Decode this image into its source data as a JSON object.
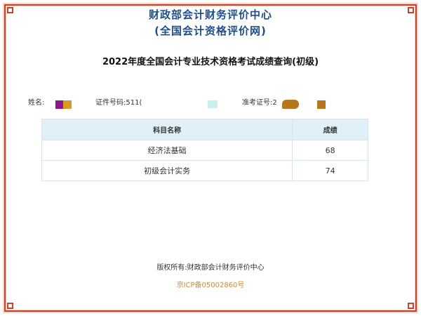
{
  "header": {
    "site_name": "财政部会计财务评价中心",
    "site_subtitle": "(全国会计资格评价网)",
    "exam_title": "2022年度全国会计专业技术资格考试成绩查询(初级)"
  },
  "candidate": {
    "name_label": "姓名:",
    "id_label": "证件号码:511(",
    "admit_label": "准考证号:2"
  },
  "scores_table": {
    "headers": {
      "subject": "科目名称",
      "score": "成绩"
    },
    "rows": [
      {
        "subject": "经济法基础",
        "score": "68"
      },
      {
        "subject": "初级会计实务",
        "score": "74"
      }
    ]
  },
  "footer": {
    "copyright": "版权所有:财政部会计财务评价中心",
    "icp": "京ICP备05002860号"
  },
  "colors": {
    "title_blue": "#1f4e8c",
    "frame_red": "#c8432b",
    "header_bg": "#dff0f9",
    "icp_color": "#c98a3c"
  }
}
